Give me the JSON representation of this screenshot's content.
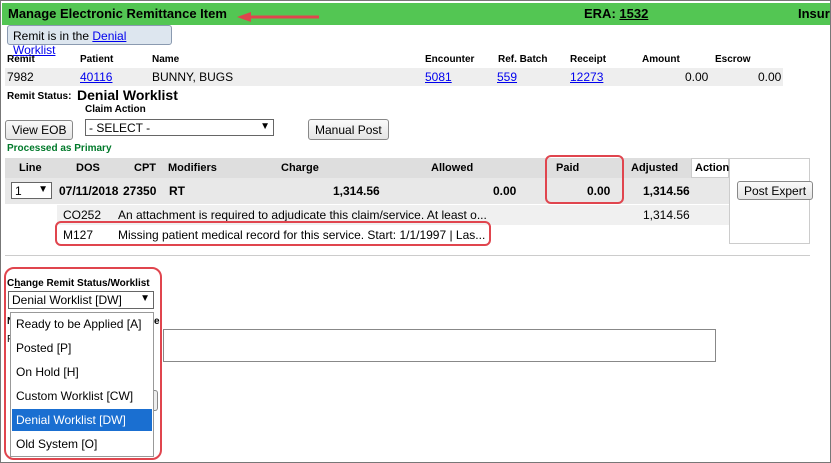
{
  "header": {
    "title": "Manage Electronic Remittance Item",
    "era_label": "ERA:",
    "era_number": "1532",
    "ins_label": "Insur",
    "bg_color": "#53c653"
  },
  "remit_tab": {
    "prefix": "Remit is in the ",
    "link": "Denial Worklist"
  },
  "remit_table": {
    "headers": [
      "Remit",
      "Patient",
      "Name",
      "Encounter",
      "Ref. Batch",
      "Receipt",
      "Amount",
      "Escrow"
    ],
    "row": {
      "remit": "7982",
      "patient": "40116",
      "name": "BUNNY, BUGS",
      "encounter": "5081",
      "ref_batch": "559",
      "receipt": "12273",
      "amount": "0.00",
      "escrow": "0.00"
    }
  },
  "remit_status": {
    "label": "Remit Status:",
    "value": "Denial Worklist"
  },
  "claim_action": {
    "label": "Claim Action",
    "selected": "- SELECT -"
  },
  "buttons": {
    "view_eob": "View EOB",
    "manual_post": "Manual Post",
    "post_expert": "Post Expert"
  },
  "processed_text": "Processed as Primary",
  "line_table": {
    "headers": [
      "Line",
      "DOS",
      "CPT",
      "Modifiers",
      "Charge",
      "Allowed",
      "Paid",
      "Adjusted",
      "Action"
    ],
    "row": {
      "line": "1",
      "dos": "07/11/2018",
      "cpt": "27350",
      "modifiers": "RT",
      "charge": "1,314.56",
      "allowed": "0.00",
      "paid": "0.00",
      "adjusted": "1,314.56"
    },
    "reasons": [
      {
        "code": "CO252",
        "text": "An attachment is required to adjudicate this claim/service. At least o...",
        "amount": "1,314.56"
      },
      {
        "code": "M127",
        "text": "Missing patient medical record for this service. Start: 1/1/1997 | Las...",
        "amount": ""
      }
    ]
  },
  "change_status": {
    "label_prefix": "C",
    "label_accel": "h",
    "label_rest": "ange Remit Status/Worklist",
    "selected": "Denial Worklist [DW]",
    "options": [
      "Ready to be Applied [A]",
      "Posted [P]",
      "On Hold [H]",
      "Custom Worklist [CW]",
      "Denial Worklist [DW]",
      "Old System [O]"
    ],
    "selected_index": 4,
    "hidden_label_start": "N",
    "hidden_label_end": "e",
    "hidden_label_p": "P"
  },
  "colors": {
    "highlight": "#e0454e",
    "selected_option": "#1a6fd1",
    "processed": "#00792a"
  }
}
